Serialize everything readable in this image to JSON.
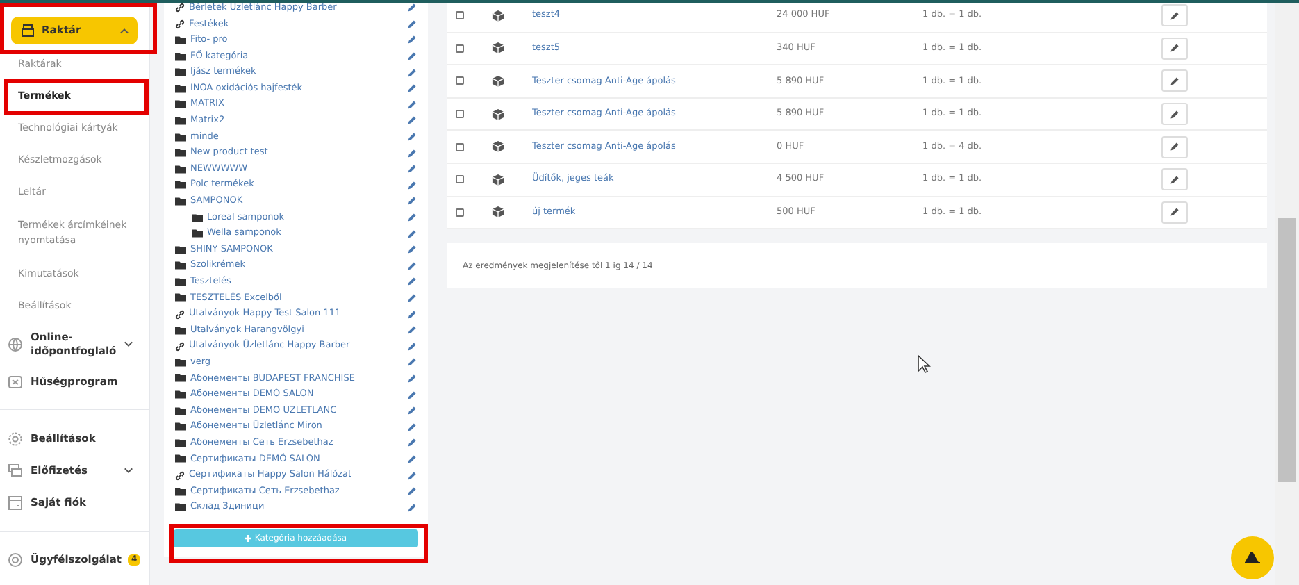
{
  "sidebar": {
    "section": {
      "label": "Raktár",
      "expanded": true,
      "selected": true
    },
    "sub_items": [
      {
        "label": "Raktárak",
        "selected": false
      },
      {
        "label": "Termékek",
        "selected": true
      },
      {
        "label": "Technológiai kártyák",
        "selected": false
      },
      {
        "label": "Készletmozgások",
        "selected": false
      },
      {
        "label": "Leltár",
        "selected": false
      },
      {
        "label": "Termékek árcímkéinek nyomtatása",
        "selected": false
      },
      {
        "label": "Kimutatások",
        "selected": false
      },
      {
        "label": "Beállítások",
        "selected": false
      }
    ],
    "modules": [
      {
        "label": "Online-időpontfoglaló",
        "kind": "group"
      },
      {
        "label": "Hűségprogram",
        "kind": "link"
      }
    ],
    "account": [
      {
        "label": "Beállítások",
        "kind": "link"
      },
      {
        "label": "Előfizetés",
        "kind": "group"
      },
      {
        "label": "Saját fiók",
        "kind": "link"
      }
    ],
    "support": {
      "label": "Ügyfélszolgálat",
      "badge": "4"
    }
  },
  "category_tree": {
    "items": [
      {
        "label": "Bérletek Üzletlánc Happy Barber",
        "kind": "link"
      },
      {
        "label": "Festékek",
        "kind": "link"
      },
      {
        "label": "Fito- pro",
        "kind": "folder"
      },
      {
        "label": "FŐ kategória",
        "kind": "folder"
      },
      {
        "label": "Ijász termékek",
        "kind": "folder"
      },
      {
        "label": "INOA oxidációs hajfesték",
        "kind": "folder"
      },
      {
        "label": "MATRIX",
        "kind": "folder"
      },
      {
        "label": "Matrix2",
        "kind": "folder"
      },
      {
        "label": "minde",
        "kind": "folder"
      },
      {
        "label": "New product test",
        "kind": "folder"
      },
      {
        "label": "NEWWWWW",
        "kind": "folder"
      },
      {
        "label": "Polc termékek",
        "kind": "folder"
      },
      {
        "label": "SAMPONOK",
        "kind": "folder",
        "children": [
          {
            "label": "Loreal samponok",
            "kind": "folder"
          },
          {
            "label": "Wella samponok",
            "kind": "folder"
          }
        ]
      },
      {
        "label": "SHINY SAMPONOK",
        "kind": "folder"
      },
      {
        "label": "Szolikrémek",
        "kind": "folder"
      },
      {
        "label": "Tesztelés",
        "kind": "folder"
      },
      {
        "label": "TESZTELÉS Excelből",
        "kind": "folder"
      },
      {
        "label": "Utalványok Happy Test Salon 111",
        "kind": "link"
      },
      {
        "label": "Utalványok Harangvölgyi",
        "kind": "folder"
      },
      {
        "label": "Utalványok Üzletlánc Happy Barber",
        "kind": "link"
      },
      {
        "label": "verg",
        "kind": "folder"
      },
      {
        "label": "Абонементы BUDAPEST FRANCHISE",
        "kind": "folder"
      },
      {
        "label": "Абонементы DEMÓ SALON",
        "kind": "folder"
      },
      {
        "label": "Абонементы DEMO UZLETLANC",
        "kind": "folder"
      },
      {
        "label": "Абонементы Üzletlánc Miron",
        "kind": "folder"
      },
      {
        "label": "Абонементы Сеть Erzsebethaz",
        "kind": "folder"
      },
      {
        "label": "Сертификаты DEMÓ SALON",
        "kind": "folder"
      },
      {
        "label": "Сертификаты Happy Salon Hálózat",
        "kind": "link"
      },
      {
        "label": "Сертификаты Сеть Erzsebethaz",
        "kind": "folder"
      },
      {
        "label": "Склад Здиници",
        "kind": "folder"
      }
    ],
    "add_button": "Kategória hozzáadása"
  },
  "products": {
    "rows": [
      {
        "name": "teszt4",
        "price": "24 000 HUF",
        "unit": "1 db. = 1 db.",
        "checked": false
      },
      {
        "name": "teszt5",
        "price": "340 HUF",
        "unit": "1 db. = 1 db.",
        "checked": false
      },
      {
        "name": "Teszter csomag Anti-Age ápolás",
        "price": "5 890 HUF",
        "unit": "1 db. = 1 db.",
        "checked": false
      },
      {
        "name": "Teszter csomag Anti-Age ápolás",
        "price": "5 890 HUF",
        "unit": "1 db. = 1 db.",
        "checked": false
      },
      {
        "name": "Teszter csomag Anti-Age ápolás",
        "price": "0 HUF",
        "unit": "1 db. = 4 db.",
        "checked": false
      },
      {
        "name": "Üdítők, jeges teák",
        "price": "4 500 HUF",
        "unit": "1 db. = 1 db.",
        "checked": false
      },
      {
        "name": "új termék",
        "price": "500 HUF",
        "unit": "1 db. = 1 db.",
        "checked": false
      }
    ],
    "footer": "Az eredmények megjelenítése től 1 ig 14 / 14"
  }
}
